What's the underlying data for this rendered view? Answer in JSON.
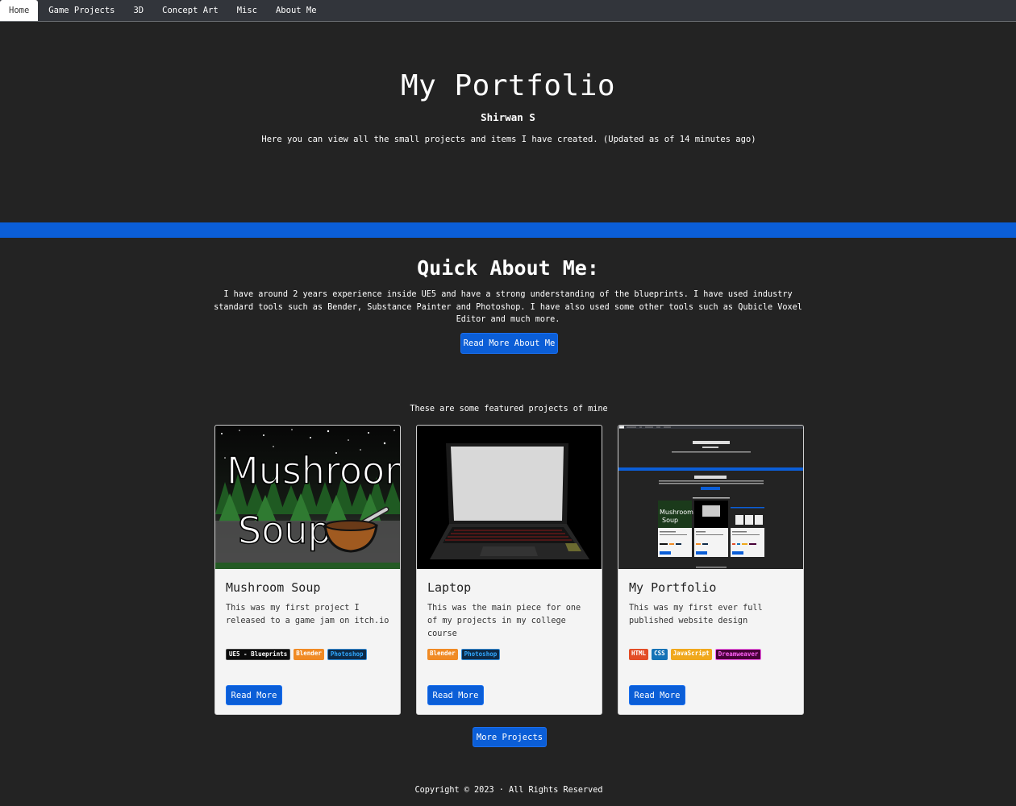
{
  "nav": {
    "items": [
      {
        "label": "Home",
        "active": true
      },
      {
        "label": "Game Projects"
      },
      {
        "label": "3D"
      },
      {
        "label": "Concept Art"
      },
      {
        "label": "Misc"
      },
      {
        "label": "About Me"
      }
    ]
  },
  "hero": {
    "title": "My Portfolio",
    "subtitle": "Shirwan S",
    "description": "Here you can view all the small projects and items I have created. (Updated as of 14 minutes ago)"
  },
  "about": {
    "title": "Quick About Me:",
    "text": "I have around 2 years experience inside UE5 and have a strong understanding of the blueprints. I have used industry standard tools such as Bender, Substance Painter and Photoshop. I have also used some other tools such as Qubicle Voxel Editor and much more.",
    "button_label": "Read More About Me"
  },
  "featured": {
    "caption": "These are some featured projects of mine",
    "cards": [
      {
        "title": "Mushroom Soup",
        "text": "This was my first project I released to a game jam on itch.io",
        "image_text_line1": "Mushroom",
        "image_text_line2": "Soup",
        "tags": [
          {
            "label": "UE5 - Blueprints",
            "color": "#0a0a0a",
            "border": "#444"
          },
          {
            "label": "Blender",
            "color": "#f08a24",
            "border": "#f08a24"
          },
          {
            "label": "Photoshop",
            "color": "#0e2a47",
            "border": "#2f8ad7",
            "text": "#31a8ff"
          }
        ],
        "button_label": "Read More"
      },
      {
        "title": "Laptop",
        "text": "This was the main piece for one of my projects in my college course",
        "tags": [
          {
            "label": "Blender",
            "color": "#f08a24",
            "border": "#f08a24"
          },
          {
            "label": "Photoshop",
            "color": "#0e2a47",
            "border": "#2f8ad7",
            "text": "#31a8ff"
          }
        ],
        "button_label": "Read More"
      },
      {
        "title": "My Portfolio",
        "text": "This was my first ever full published website design",
        "tags": [
          {
            "label": "HTML",
            "color": "#e34c26",
            "border": "#e34c26"
          },
          {
            "label": "CSS",
            "color": "#1572b6",
            "border": "#1572b6"
          },
          {
            "label": "JavaScript",
            "color": "#f0a81c",
            "border": "#f0a81c"
          },
          {
            "label": "Dreamweaver",
            "color": "#470137",
            "border": "#ff61f6",
            "text": "#ff61f6"
          }
        ],
        "button_label": "Read More"
      }
    ],
    "more_button_label": "More Projects"
  },
  "footer": {
    "text": "Copyright © 2023 · All Rights Reserved"
  },
  "colors": {
    "background": "#232323",
    "accent": "#0b5ed7",
    "card": "#f4f4f4"
  }
}
